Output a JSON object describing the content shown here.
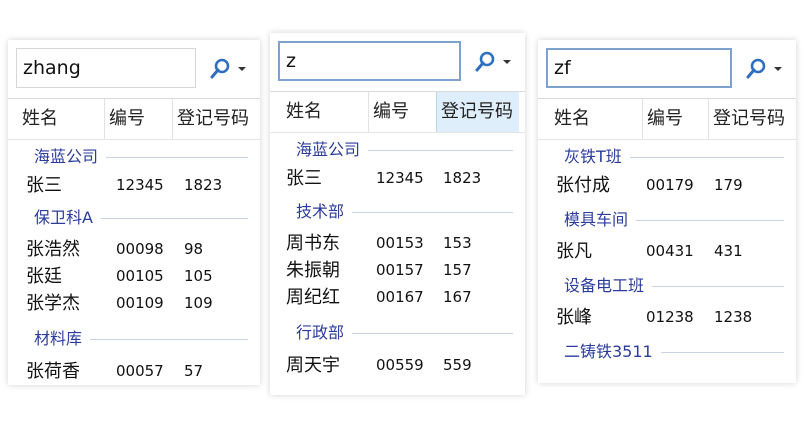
{
  "panels": [
    {
      "search_value": "zhang",
      "focused": false,
      "columns": [
        "姓名",
        "编号",
        "登记号码"
      ],
      "groups": [
        {
          "name": "海蓝公司",
          "rows": [
            {
              "name": "张三",
              "id": "12345",
              "reg": "1823"
            }
          ]
        },
        {
          "name": "保卫科A",
          "rows": [
            {
              "name": "张浩然",
              "id": "00098",
              "reg": "98"
            },
            {
              "name": "张廷",
              "id": "00105",
              "reg": "105"
            },
            {
              "name": "张学杰",
              "id": "00109",
              "reg": "109"
            }
          ]
        },
        {
          "name": "材料库",
          "rows": [
            {
              "name": "张荷香",
              "id": "00057",
              "reg": "57"
            }
          ]
        }
      ]
    },
    {
      "search_value": "z",
      "focused": true,
      "columns": [
        "姓名",
        "编号",
        "登记号码"
      ],
      "groups": [
        {
          "name": "海蓝公司",
          "rows": [
            {
              "name": "张三",
              "id": "12345",
              "reg": "1823"
            }
          ]
        },
        {
          "name": "技术部",
          "rows": [
            {
              "name": "周书东",
              "id": "00153",
              "reg": "153"
            },
            {
              "name": "朱振朝",
              "id": "00157",
              "reg": "157"
            },
            {
              "name": "周纪红",
              "id": "00167",
              "reg": "167"
            }
          ]
        },
        {
          "name": "行政部",
          "rows": [
            {
              "name": "周天宇",
              "id": "00559",
              "reg": "559"
            }
          ]
        }
      ]
    },
    {
      "search_value": "zf",
      "focused": true,
      "columns": [
        "姓名",
        "编号",
        "登记号码"
      ],
      "groups": [
        {
          "name": "灰铁T班",
          "rows": [
            {
              "name": "张付成",
              "id": "00179",
              "reg": "179"
            }
          ]
        },
        {
          "name": "模具车间",
          "rows": [
            {
              "name": "张凡",
              "id": "00431",
              "reg": "431"
            }
          ]
        },
        {
          "name": "设备电工班",
          "rows": [
            {
              "name": "张峰",
              "id": "01238",
              "reg": "1238"
            }
          ]
        },
        {
          "name": "二铸铁3511",
          "rows": []
        }
      ]
    }
  ]
}
